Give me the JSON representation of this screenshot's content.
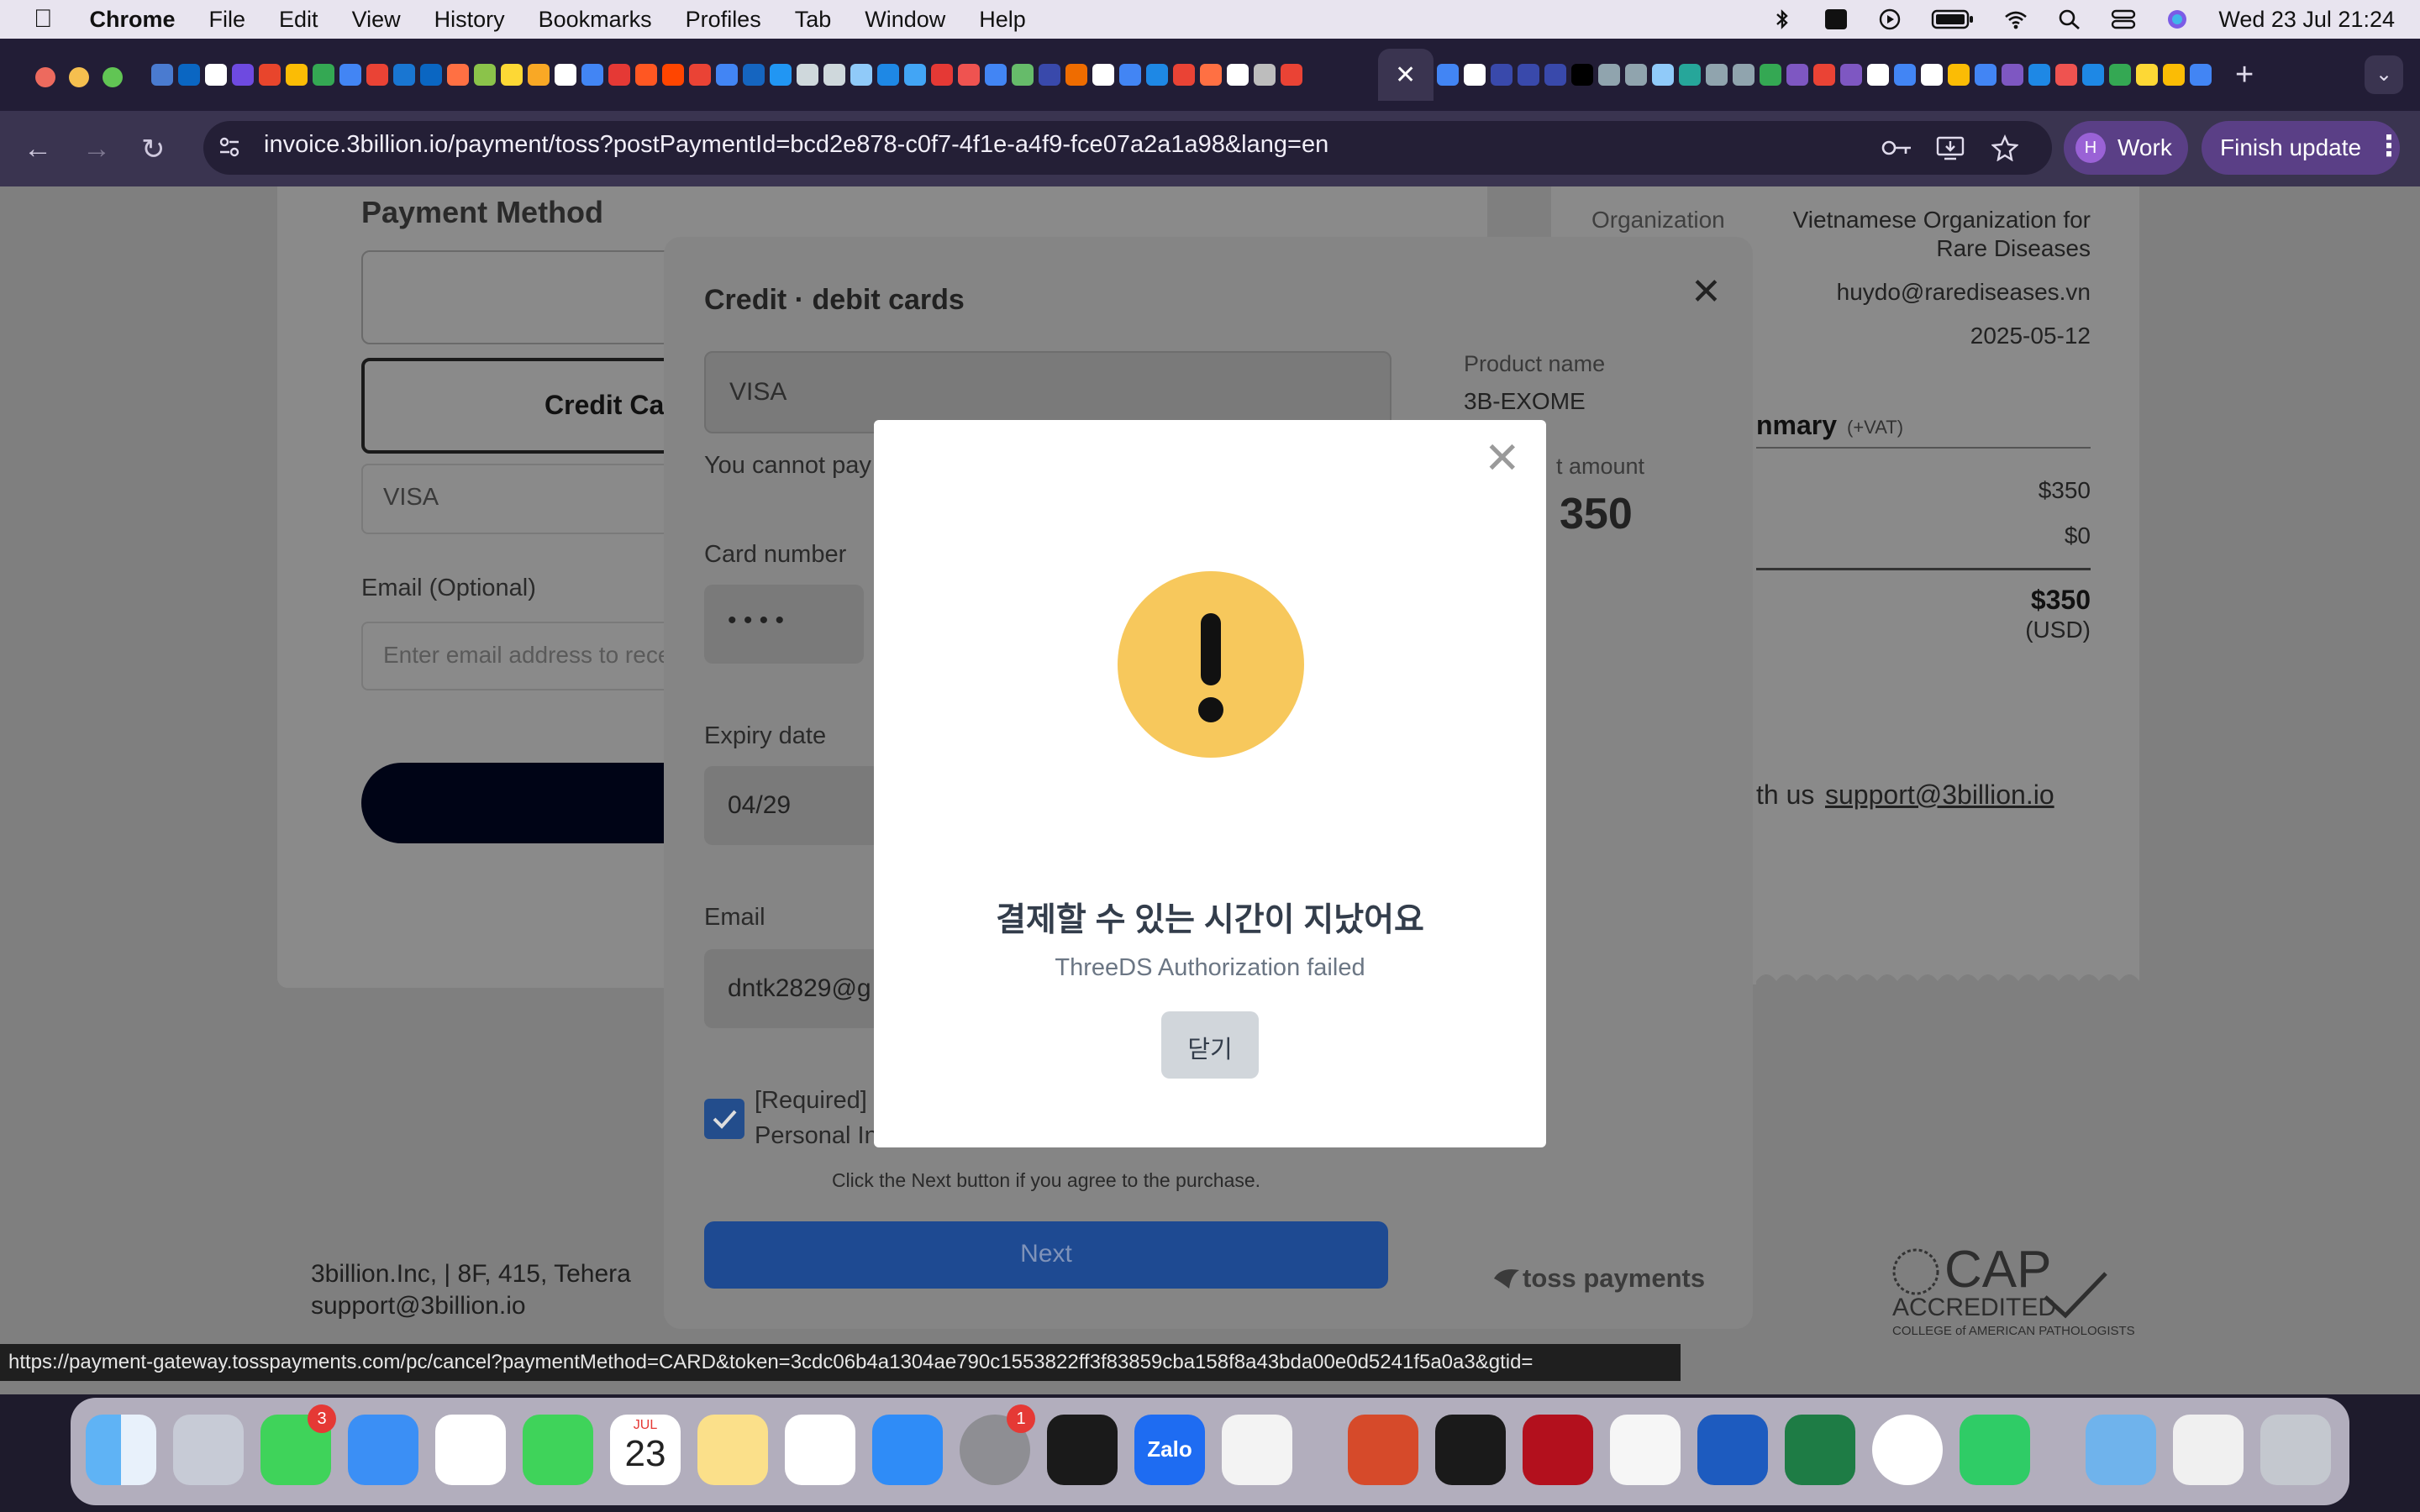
{
  "menubar": {
    "app_name": "Chrome",
    "items": [
      "File",
      "Edit",
      "View",
      "History",
      "Bookmarks",
      "Profiles",
      "Tab",
      "Window",
      "Help"
    ],
    "datetime": "Wed 23 Jul  21:24"
  },
  "browser": {
    "url": "invoice.3billion.io/payment/toss?postPaymentId=bcd2e878-c0f7-4f1e-a4f9-fce07a2a1a98&lang=en",
    "profile_initial": "H",
    "profile_label": "Work",
    "finish_update_label": "Finish update",
    "status_url": "https://payment-gateway.tosspayments.com/pc/cancel?paymentMethod=CARD&token=3cdc06b4a1304ae790c1553822ff3f83859cba158f8a43bda00e0d5241f5a0a3&gtid="
  },
  "invoice": {
    "payment_method_title": "Payment Method",
    "credit_card_button": "Credit Ca",
    "card_brand": "VISA",
    "email_label": "Email (Optional)",
    "email_placeholder": "Enter email address to rece",
    "organization_label": "Organization",
    "organization_value_line1": "Vietnamese Organization for",
    "organization_value_line2": "Rare Diseases",
    "email_value": "huydo@rarediseases.vn",
    "date_value": "2025-05-12",
    "summary_title": "nmary",
    "summary_vat": "(+VAT)",
    "subtotal": "$350",
    "discount": "$0",
    "total": "$350",
    "currency": "(USD)",
    "contact_prefix": "th us",
    "support_email": "support@3billion.io",
    "footer_company": "3billion.Inc,  |  8F, 415, Tehera",
    "footer_email": "support@3billion.io",
    "cap_main": "CAP",
    "cap_accredited": "ACCREDITED",
    "cap_sub": "COLLEGE of AMERICAN PATHOLOGISTS"
  },
  "toss_panel": {
    "title": "Credit · debit cards",
    "card_brand": "VISA",
    "warning": "You cannot pay",
    "card_number_label": "Card number",
    "card_number_value": "• • • •",
    "expiry_label": "Expiry date",
    "expiry_value": "04/29",
    "email_label": "Email",
    "email_value": "dntk2829@g",
    "consent_line1": "[Required]",
    "consent_line2": "Personal In",
    "agree_text": "Click the Next button if you agree to the purchase.",
    "next_button": "Next",
    "product_name_label": "Product name",
    "product_name_value": "3B-EXOME",
    "amount_label": "t amount",
    "amount_value": "350",
    "brand": "toss payments"
  },
  "modal": {
    "title": "결제할 수 있는 시간이 지났어요",
    "message": "ThreeDS Authorization failed",
    "close_button": "닫기",
    "icon_color": "#f7c85c"
  },
  "dock": {
    "messages_badge": "3",
    "settings_badge": "1",
    "calendar_month": "JUL",
    "calendar_day": "23",
    "zalo_label": "Zalo"
  }
}
